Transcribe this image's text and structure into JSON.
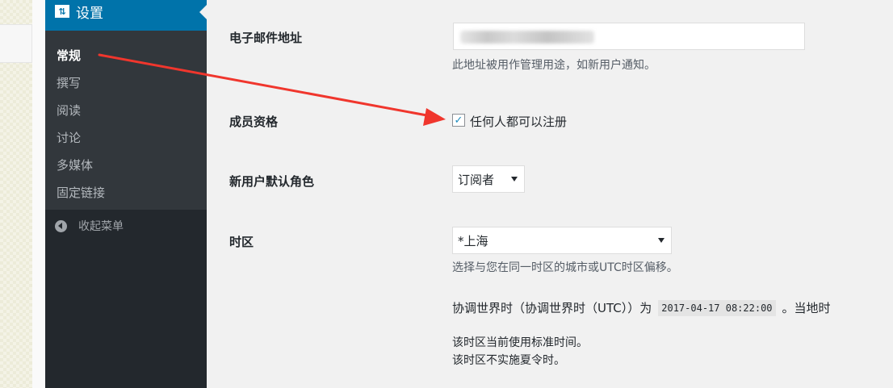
{
  "sidebar": {
    "header_label": "设置",
    "header_icon": "settings-icon",
    "items": [
      {
        "label": "常规",
        "current": true
      },
      {
        "label": "撰写"
      },
      {
        "label": "阅读"
      },
      {
        "label": "讨论"
      },
      {
        "label": "多媒体"
      },
      {
        "label": "固定链接"
      }
    ],
    "collapse_label": "收起菜单"
  },
  "form": {
    "email": {
      "label": "电子邮件地址",
      "value": "",
      "description": "此地址被用作管理用途，如新用户通知。"
    },
    "membership": {
      "label": "成员资格",
      "checkbox_checked": true,
      "checkbox_label": "任何人都可以注册"
    },
    "default_role": {
      "label": "新用户默认角色",
      "selected": "订阅者"
    },
    "timezone": {
      "label": "时区",
      "selected": "*上海",
      "description": "选择与您在同一时区的城市或UTC时区偏移。",
      "utc_prefix": "协调世界时（协调世界时（UTC））为",
      "utc_time": "2017-04-17 08:22:00",
      "utc_suffix": "。当地时",
      "dst_note_1": "该时区当前使用标准时间。",
      "dst_note_2": "该时区不实施夏令时。"
    }
  },
  "colors": {
    "sidebar_bg": "#23282d",
    "submenu_bg": "#32373c",
    "accent": "#0073aa",
    "annotation_arrow": "#f0362d"
  }
}
